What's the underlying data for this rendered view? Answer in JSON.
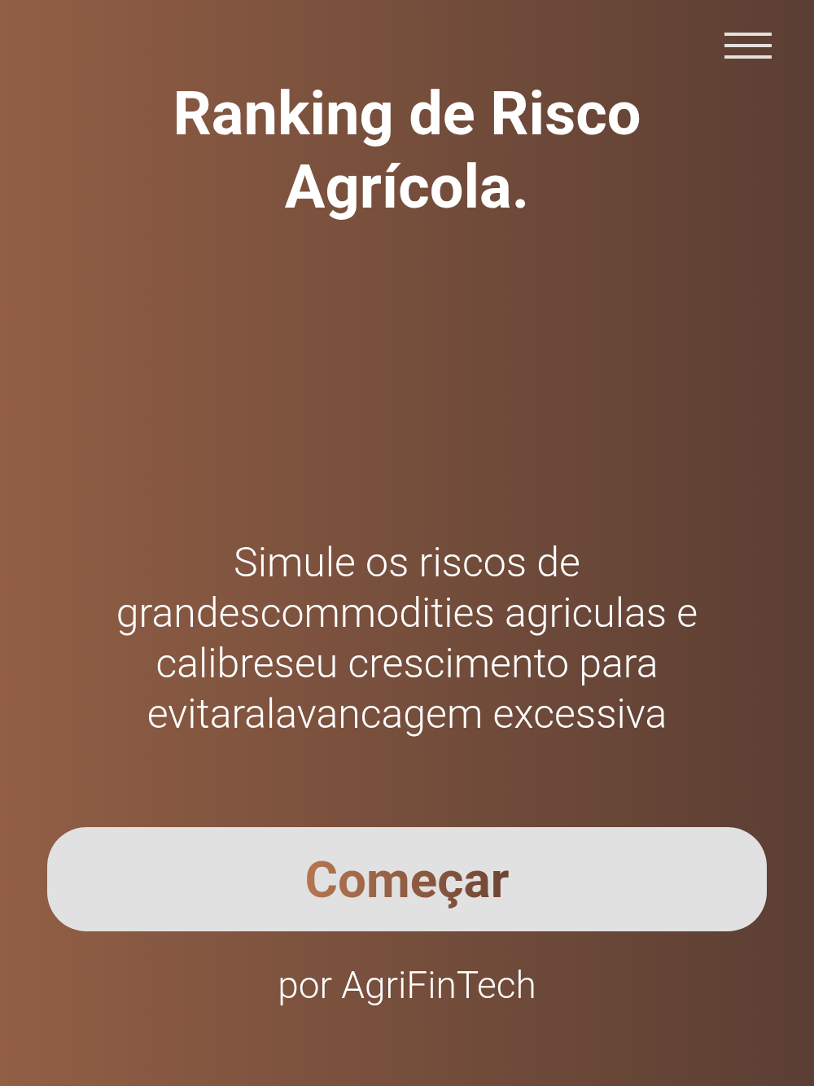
{
  "title": "Ranking de Risco Agrícola.",
  "description": "Simule os riscos de grandescommodities agriculas e calibreseu crescimento para evitaralavancagem excessiva",
  "button": {
    "label": "Começar"
  },
  "footer": "por AgriFinTech"
}
